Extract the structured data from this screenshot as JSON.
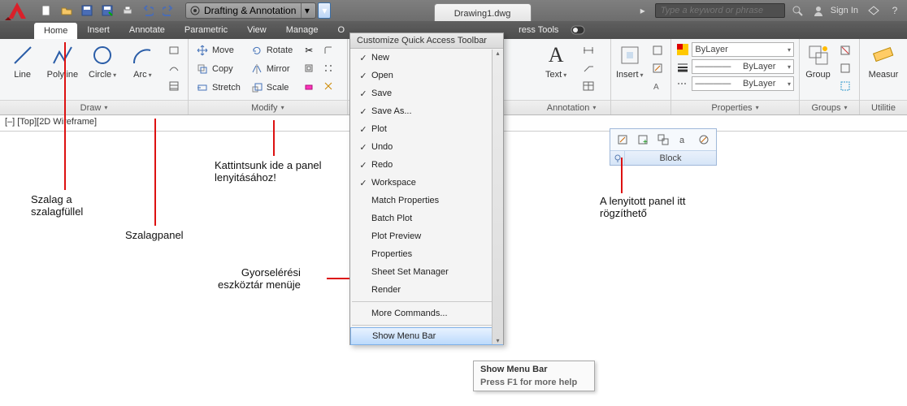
{
  "title_tab": "Drawing1.dwg",
  "workspace_label": "Drafting & Annotation",
  "search_placeholder": "Type a keyword or phrase",
  "signin_label": "Sign In",
  "tabs": {
    "home": "Home",
    "insert": "Insert",
    "annotate": "Annotate",
    "parametric": "Parametric",
    "view": "View",
    "manage": "Manage",
    "output_cut": "O",
    "express": "ress Tools"
  },
  "qat_popup_title": "Customize Quick Access Toolbar",
  "draw": {
    "title": "Draw",
    "line": "Line",
    "polyline": "Polyline",
    "circle": "Circle",
    "arc": "Arc"
  },
  "modify": {
    "title": "Modify",
    "move": "Move",
    "copy": "Copy",
    "stretch": "Stretch",
    "rotate": "Rotate",
    "mirror": "Mirror",
    "scale": "Scale"
  },
  "annotation": {
    "title": "Annotation",
    "text": "Text"
  },
  "block": {
    "title_ribbon": "",
    "insert": "Insert",
    "float_title": "Block"
  },
  "properties": {
    "title": "Properties",
    "bylayer": "ByLayer"
  },
  "groups": {
    "title": "Groups",
    "group": "Group"
  },
  "utilities": {
    "title": "Utilitie",
    "measure": "Measur"
  },
  "qat_menu": {
    "new": "New",
    "open": "Open",
    "save": "Save",
    "saveas": "Save As...",
    "plot": "Plot",
    "undo": "Undo",
    "redo": "Redo",
    "workspace": "Workspace",
    "matchprop": "Match Properties",
    "batchplot": "Batch Plot",
    "plotpreview": "Plot Preview",
    "properties": "Properties",
    "ssm": "Sheet Set Manager",
    "render": "Render",
    "more": "More Commands...",
    "menubar": "Show Menu Bar"
  },
  "tooltip": {
    "title": "Show Menu Bar",
    "help": "Press F1 for more help"
  },
  "viewport": "[–] [Top][2D Wireframe]",
  "ann": {
    "a1": "Szalag a\nszalagfüllel",
    "a2": "Szalagpanel",
    "a3": "Kattintsunk ide a panel\nlenyitásához!",
    "a4": "Gyorselérési\neszköztár menüje",
    "a5": "A lenyitott panel itt\nrögzíthető"
  }
}
